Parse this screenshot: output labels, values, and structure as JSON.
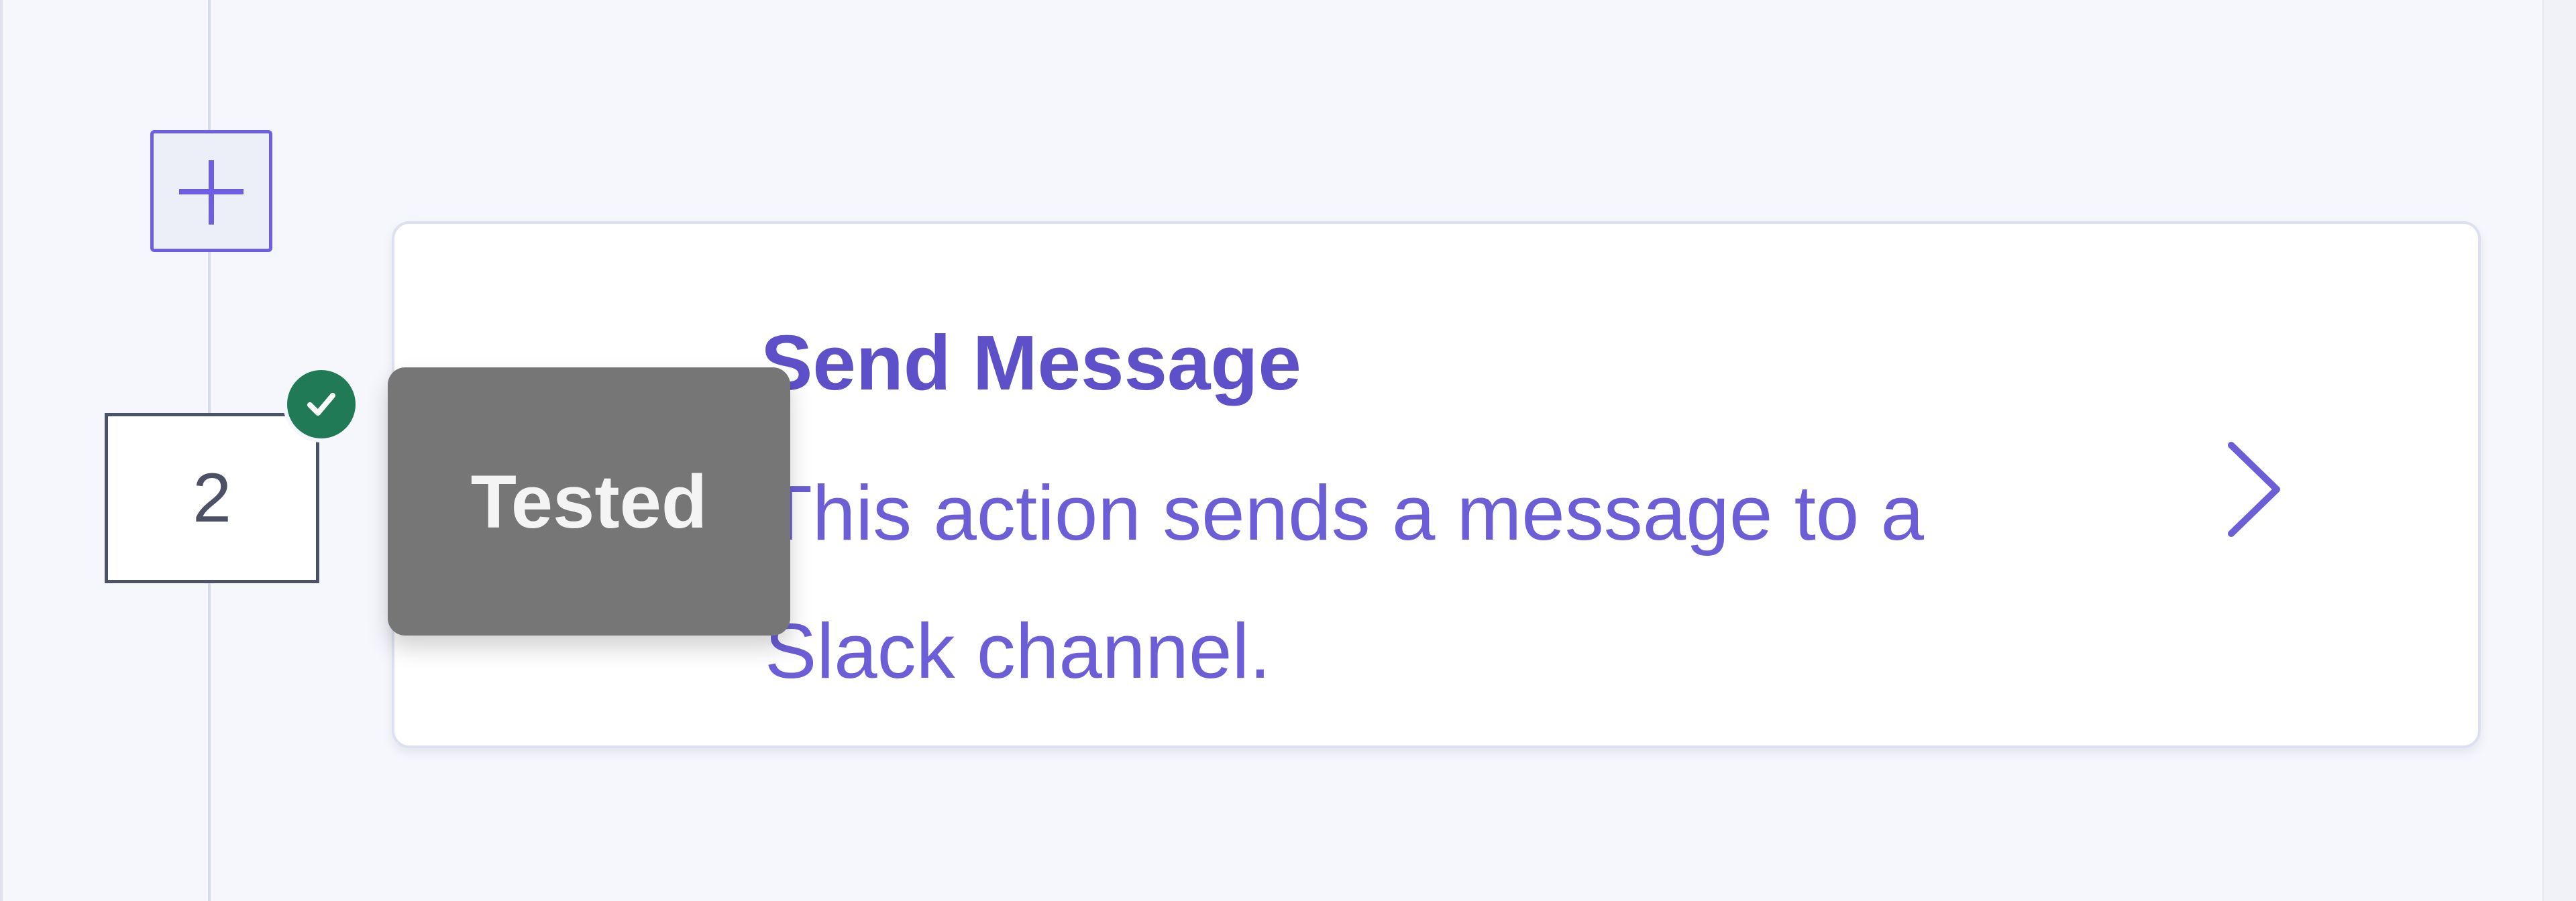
{
  "step": {
    "number": "2",
    "status_icon": "check-icon",
    "status_color": "#1f7a55",
    "tooltip": "Tested"
  },
  "card": {
    "title": "Send Message",
    "description": "This action sends a message to a Slack channel.",
    "accent_color": "#5e50c8",
    "chevron_icon": "chevron-right-icon"
  },
  "timeline": {
    "add_icon": "plus-icon"
  }
}
